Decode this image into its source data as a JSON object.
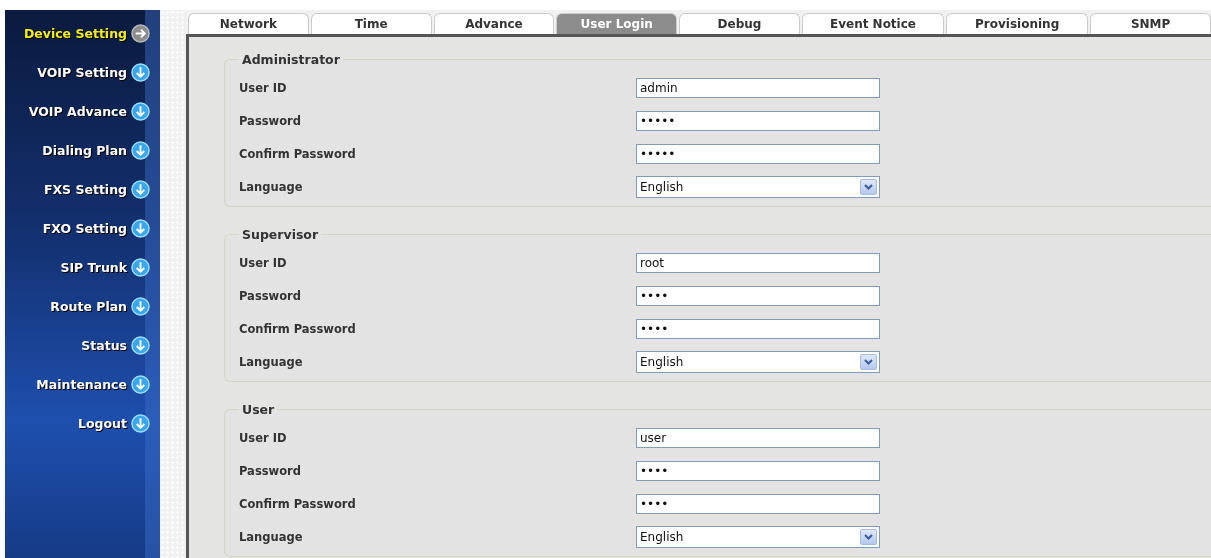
{
  "sidebar": {
    "items": [
      {
        "label": "Device Setting",
        "selected": true
      },
      {
        "label": "VOIP Setting",
        "selected": false
      },
      {
        "label": "VOIP Advance",
        "selected": false
      },
      {
        "label": "Dialing Plan",
        "selected": false
      },
      {
        "label": "FXS Setting",
        "selected": false
      },
      {
        "label": "FXO Setting",
        "selected": false
      },
      {
        "label": "SIP Trunk",
        "selected": false
      },
      {
        "label": "Route Plan",
        "selected": false
      },
      {
        "label": "Status",
        "selected": false
      },
      {
        "label": "Maintenance",
        "selected": false
      },
      {
        "label": "Logout",
        "selected": false
      }
    ]
  },
  "tabs": [
    {
      "label": "Network",
      "selected": false
    },
    {
      "label": "Time",
      "selected": false
    },
    {
      "label": "Advance",
      "selected": false
    },
    {
      "label": "User Login",
      "selected": true
    },
    {
      "label": "Debug",
      "selected": false
    },
    {
      "label": "Event Notice",
      "selected": false
    },
    {
      "label": "Provisioning",
      "selected": false
    },
    {
      "label": "SNMP",
      "selected": false
    }
  ],
  "sections": [
    {
      "title": "Administrator",
      "fields": [
        {
          "label": "User ID",
          "kind": "text",
          "value": "admin"
        },
        {
          "label": "Password",
          "kind": "text",
          "value": "•••••"
        },
        {
          "label": "Confirm Password",
          "kind": "text",
          "value": "•••••"
        },
        {
          "label": "Language",
          "kind": "select",
          "value": "English"
        }
      ]
    },
    {
      "title": "Supervisor",
      "fields": [
        {
          "label": "User ID",
          "kind": "text",
          "value": "root"
        },
        {
          "label": "Password",
          "kind": "text",
          "value": "••••"
        },
        {
          "label": "Confirm Password",
          "kind": "text",
          "value": "••••"
        },
        {
          "label": "Language",
          "kind": "select",
          "value": "English"
        }
      ]
    },
    {
      "title": "User",
      "fields": [
        {
          "label": "User ID",
          "kind": "text",
          "value": "user"
        },
        {
          "label": "Password",
          "kind": "text",
          "value": "••••"
        },
        {
          "label": "Confirm Password",
          "kind": "text",
          "value": "••••"
        },
        {
          "label": "Language",
          "kind": "select",
          "value": "English"
        }
      ]
    }
  ]
}
